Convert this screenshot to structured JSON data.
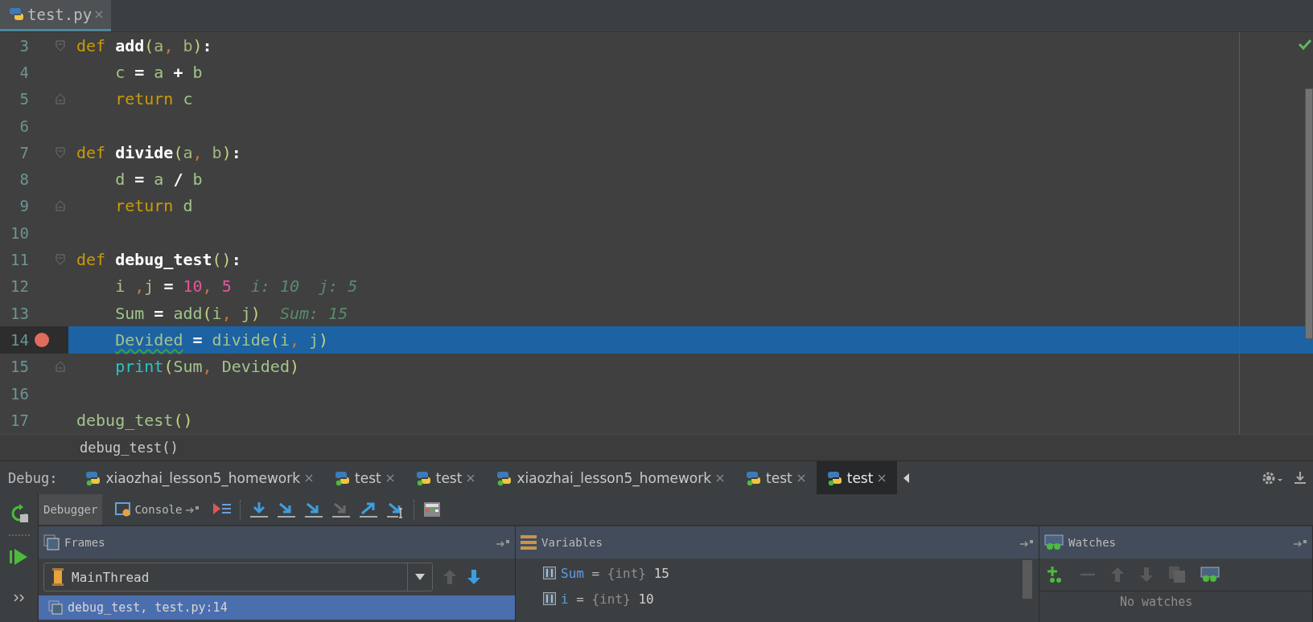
{
  "editor_tabs": [
    {
      "label": "test.py",
      "selected": true
    }
  ],
  "code_lines": [
    {
      "number": "3",
      "fold_start": true,
      "fold_end": false,
      "breakpoint": false,
      "current": false,
      "tokens": [
        {
          "kind": "kw",
          "text": "def"
        },
        {
          "kind": "fn",
          "text": " add"
        },
        {
          "kind": "paren",
          "text": "("
        },
        {
          "kind": "param",
          "text": "a"
        },
        {
          "kind": "comma",
          "text": ","
        },
        {
          "kind": "param",
          "text": " b"
        },
        {
          "kind": "paren",
          "text": ")"
        },
        {
          "kind": "op",
          "text": ":"
        }
      ]
    },
    {
      "number": "4",
      "fold_start": false,
      "fold_end": false,
      "breakpoint": false,
      "current": false,
      "tokens": [
        {
          "kind": "var",
          "text": "    c"
        },
        {
          "kind": "op",
          "text": " = "
        },
        {
          "kind": "var",
          "text": "a"
        },
        {
          "kind": "op",
          "text": " + "
        },
        {
          "kind": "var",
          "text": "b"
        }
      ]
    },
    {
      "number": "5",
      "fold_start": false,
      "fold_end": true,
      "breakpoint": false,
      "current": false,
      "tokens": [
        {
          "kind": "kw",
          "text": "    return"
        },
        {
          "kind": "var",
          "text": " c"
        }
      ]
    },
    {
      "number": "6",
      "fold_start": false,
      "fold_end": false,
      "breakpoint": false,
      "current": false
    },
    {
      "number": "7",
      "fold_start": true,
      "fold_end": false,
      "breakpoint": false,
      "current": false,
      "tokens": [
        {
          "kind": "kw",
          "text": "def"
        },
        {
          "kind": "fn",
          "text": " divide"
        },
        {
          "kind": "paren",
          "text": "("
        },
        {
          "kind": "param",
          "text": "a"
        },
        {
          "kind": "comma",
          "text": ","
        },
        {
          "kind": "param",
          "text": " b"
        },
        {
          "kind": "paren",
          "text": ")"
        },
        {
          "kind": "op",
          "text": ":"
        }
      ]
    },
    {
      "number": "8",
      "fold_start": false,
      "fold_end": false,
      "breakpoint": false,
      "current": false,
      "tokens": [
        {
          "kind": "var",
          "text": "    d"
        },
        {
          "kind": "op",
          "text": " = "
        },
        {
          "kind": "var",
          "text": "a"
        },
        {
          "kind": "op",
          "text": " / "
        },
        {
          "kind": "var",
          "text": "b"
        }
      ]
    },
    {
      "number": "9",
      "fold_start": false,
      "fold_end": true,
      "breakpoint": false,
      "current": false,
      "tokens": [
        {
          "kind": "kw",
          "text": "    return"
        },
        {
          "kind": "var",
          "text": " d"
        }
      ]
    },
    {
      "number": "10",
      "fold_start": false,
      "fold_end": false,
      "breakpoint": false,
      "current": false
    },
    {
      "number": "11",
      "fold_start": true,
      "fold_end": false,
      "breakpoint": false,
      "current": false,
      "tokens": [
        {
          "kind": "kw",
          "text": "def"
        },
        {
          "kind": "fn",
          "text": " debug_test"
        },
        {
          "kind": "paren",
          "text": "()"
        },
        {
          "kind": "op",
          "text": ":"
        }
      ]
    },
    {
      "number": "12",
      "fold_start": false,
      "fold_end": false,
      "breakpoint": false,
      "current": false,
      "tokens": [
        {
          "kind": "var",
          "text": "    i "
        },
        {
          "kind": "comma",
          "text": ","
        },
        {
          "kind": "var",
          "text": "j"
        },
        {
          "kind": "op",
          "text": " = "
        },
        {
          "kind": "num",
          "text": "10"
        },
        {
          "kind": "comma",
          "text": ","
        },
        {
          "kind": "num",
          "text": " 5"
        },
        {
          "kind": "hint",
          "text": "  i: 10  j: 5"
        }
      ]
    },
    {
      "number": "13",
      "fold_start": false,
      "fold_end": false,
      "breakpoint": false,
      "current": false,
      "tokens": [
        {
          "kind": "var",
          "text": "    Sum"
        },
        {
          "kind": "op",
          "text": " = "
        },
        {
          "kind": "var",
          "text": "add"
        },
        {
          "kind": "paren",
          "text": "("
        },
        {
          "kind": "var",
          "text": "i"
        },
        {
          "kind": "comma",
          "text": ","
        },
        {
          "kind": "var",
          "text": " j"
        },
        {
          "kind": "paren",
          "text": ")"
        },
        {
          "kind": "hint",
          "text": "  Sum: 15"
        }
      ]
    },
    {
      "number": "14",
      "fold_start": false,
      "fold_end": false,
      "breakpoint": true,
      "current": true,
      "tokens": [
        {
          "kind": "warn",
          "text": "    Devided"
        },
        {
          "kind": "op",
          "text": " = "
        },
        {
          "kind": "var",
          "text": "divide"
        },
        {
          "kind": "paren",
          "text": "("
        },
        {
          "kind": "var",
          "text": "i"
        },
        {
          "kind": "comma",
          "text": ","
        },
        {
          "kind": "var",
          "text": " j"
        },
        {
          "kind": "paren",
          "text": ")"
        }
      ]
    },
    {
      "number": "15",
      "fold_start": false,
      "fold_end": true,
      "breakpoint": false,
      "current": false,
      "tokens": [
        {
          "kind": "builtin",
          "text": "    print"
        },
        {
          "kind": "paren",
          "text": "("
        },
        {
          "kind": "var",
          "text": "Sum"
        },
        {
          "kind": "comma",
          "text": ","
        },
        {
          "kind": "var",
          "text": " Devided"
        },
        {
          "kind": "paren",
          "text": ")"
        }
      ]
    },
    {
      "number": "16",
      "fold_start": false,
      "fold_end": false,
      "breakpoint": false,
      "current": false
    },
    {
      "number": "17",
      "fold_start": false,
      "fold_end": false,
      "breakpoint": false,
      "current": false,
      "tokens": [
        {
          "kind": "var",
          "text": "debug_test"
        },
        {
          "kind": "paren",
          "text": "()"
        }
      ]
    }
  ],
  "breadcrumb": "debug_test()",
  "debug_bar": {
    "label": "Debug:",
    "tabs": [
      {
        "label": "xiaozhai_lesson5_homework",
        "selected": false
      },
      {
        "label": "test",
        "selected": false
      },
      {
        "label": "test",
        "selected": false
      },
      {
        "label": "xiaozhai_lesson5_homework",
        "selected": false
      },
      {
        "label": "test",
        "selected": false
      },
      {
        "label": "test",
        "selected": true
      }
    ]
  },
  "debug_view_tabs": [
    {
      "label": "Debugger",
      "kind": "plain",
      "selected": true
    },
    {
      "label": "Console",
      "kind": "console",
      "selected": false
    }
  ],
  "frames": {
    "title": "Frames",
    "thread": "MainThread",
    "items": [
      {
        "label": "debug_test, test.py:14",
        "selected": true
      }
    ]
  },
  "variables": {
    "title": "Variables",
    "items": [
      {
        "name": "Sum",
        "separator": "=",
        "type": "{int}",
        "value": "15"
      },
      {
        "name": "i",
        "separator": "=",
        "type": "{int}",
        "value": "10"
      }
    ]
  },
  "watches": {
    "title": "Watches",
    "empty_text": "No watches"
  }
}
